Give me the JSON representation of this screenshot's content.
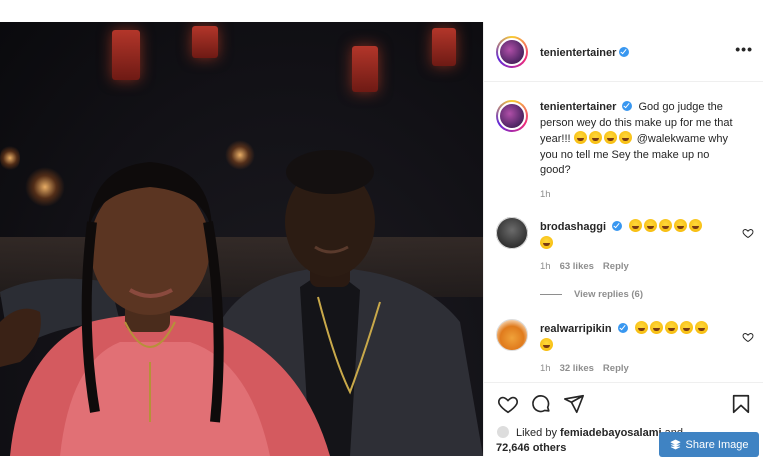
{
  "post": {
    "author": "tenientertainer",
    "verified": true,
    "menu_icon": "more-horizontal-icon"
  },
  "caption": {
    "author": "tenientertainer",
    "text": "God go judge the person wey do this make up for me that year!!!",
    "mention": "@walekwame",
    "text2": "why you no tell me Sey the make up no good?",
    "emoji_count": 4,
    "time": "1h"
  },
  "comments": [
    {
      "author": "brodashaggi",
      "emoji_count": 6,
      "time": "1h",
      "likes": "63 likes",
      "reply": "Reply",
      "view_replies": "View replies (6)"
    },
    {
      "author": "realwarripikin",
      "emoji_count": 6,
      "time": "1h",
      "likes": "32 likes",
      "reply": "Reply"
    }
  ],
  "actions": {
    "like_icon": "heart-icon",
    "comment_icon": "comment-icon",
    "share_icon": "send-icon",
    "save_icon": "bookmark-icon"
  },
  "likes": {
    "prefix": "Liked by",
    "user": "femiadebayosalami",
    "and": "and",
    "others": "72,646 others"
  },
  "share_button": {
    "label": "Share Image",
    "icon": "stack-icon",
    "color": "#3f83c3"
  },
  "colors": {
    "verified": "#3897f0",
    "muted": "#8e8e8e",
    "text": "#262626"
  }
}
